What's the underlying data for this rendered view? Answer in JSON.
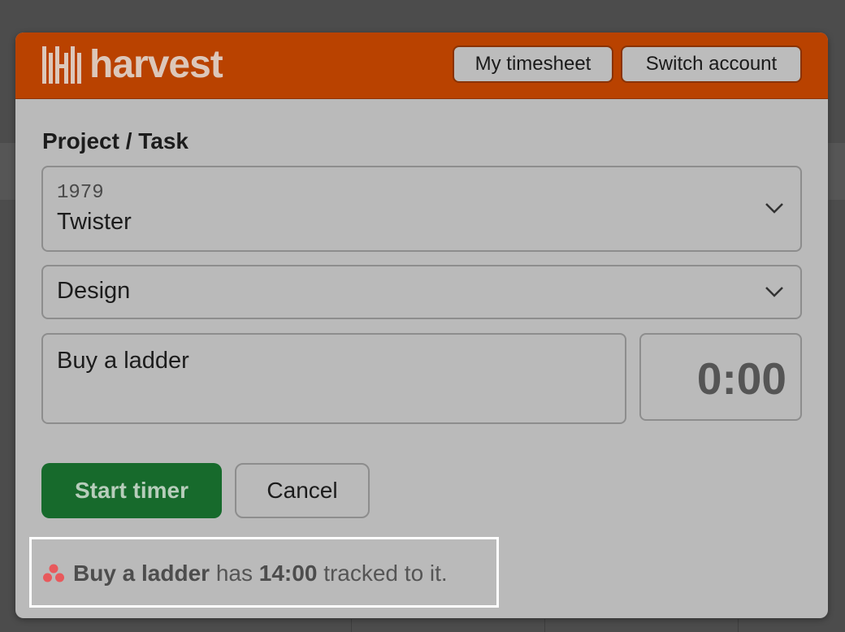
{
  "header": {
    "logo_text": "harvest",
    "my_timesheet_label": "My timesheet",
    "switch_account_label": "Switch account",
    "color": "#b94200"
  },
  "form": {
    "project_task_label": "Project / Task",
    "project": {
      "code": "1979",
      "name": "Twister"
    },
    "task": "Design",
    "notes": "Buy a ladder",
    "time": "0:00"
  },
  "actions": {
    "start_label": "Start timer",
    "cancel_label": "Cancel",
    "start_color": "#176a2c"
  },
  "notice": {
    "icon": "asana-icon",
    "task_name": "Buy a ladder",
    "text_has": "has",
    "tracked_time": "14:00",
    "text_suffix": "tracked to it."
  }
}
